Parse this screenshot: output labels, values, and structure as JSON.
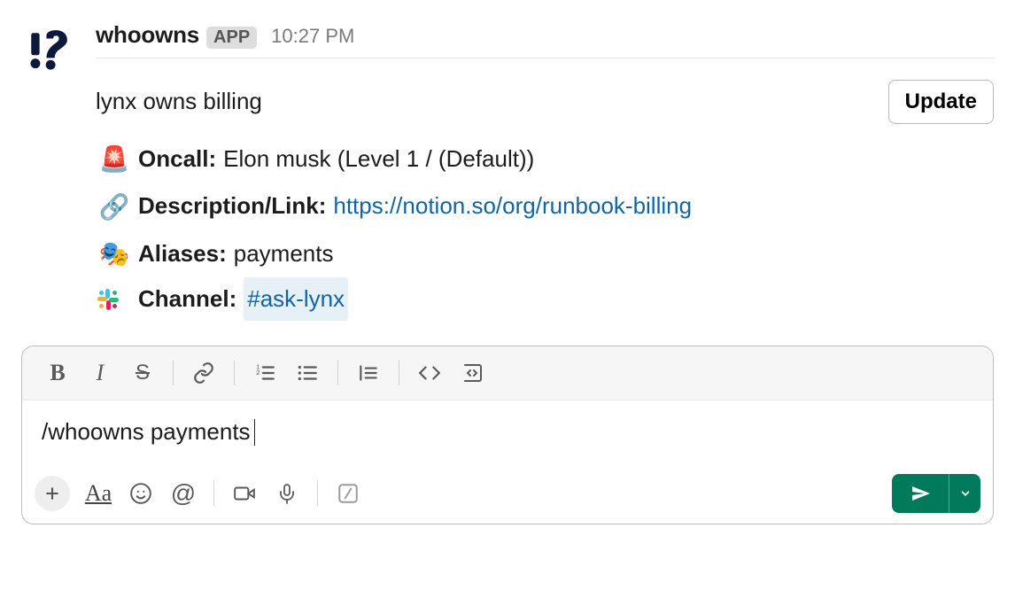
{
  "message": {
    "sender": "whoowns",
    "app_badge": "APP",
    "timestamp": "10:27 PM",
    "heading": "lynx owns billing",
    "oncall": {
      "emoji": "🚨",
      "label": "Oncall:",
      "value": "Elon musk (Level 1 / (Default))"
    },
    "description": {
      "emoji": "🔗",
      "label": "Description/Link:",
      "url": "https://notion.so/org/runbook-billing"
    },
    "aliases": {
      "emoji": "🎭",
      "label": "Aliases:",
      "value": "payments"
    },
    "channel": {
      "label": "Channel:",
      "value": "#ask-lynx"
    },
    "update_button": "Update"
  },
  "composer": {
    "input_value": "/whoowns payments"
  }
}
